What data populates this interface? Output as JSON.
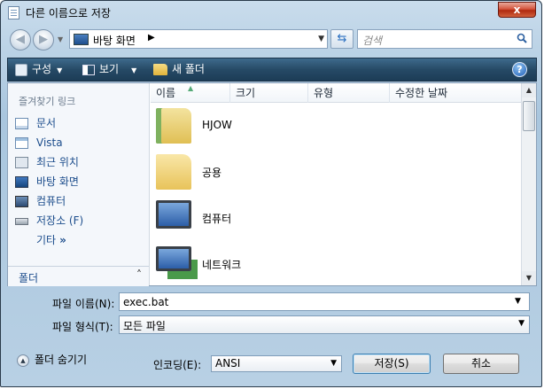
{
  "window": {
    "title": "다른 이름으로 저장",
    "close_glyph": "x"
  },
  "address": {
    "location": "바탕 화면",
    "separator": "▶",
    "search_placeholder": "검색"
  },
  "toolbar": {
    "organize": "구성",
    "views": "보기",
    "new_folder": "새 폴더",
    "help": "?"
  },
  "nav_pane": {
    "title": "즐겨찾기 링크",
    "items": [
      {
        "label": "문서",
        "icon": "documents-icon"
      },
      {
        "label": "Vista",
        "icon": "documents-icon"
      },
      {
        "label": "최근 위치",
        "icon": "recent-places-icon"
      },
      {
        "label": "바탕 화면",
        "icon": "desktop-icon"
      },
      {
        "label": "컴퓨터",
        "icon": "computer-icon"
      },
      {
        "label": "저장소 (F)",
        "icon": "drive-icon"
      }
    ],
    "more_label": "기타",
    "more_chevron": "»",
    "folders_label": "폴더"
  },
  "file_list": {
    "columns": [
      "이름",
      "크기",
      "유형",
      "수정한 날짜"
    ],
    "items": [
      {
        "name": "HJOW",
        "icon": "user-folder-icon"
      },
      {
        "name": "공용",
        "icon": "folder-icon"
      },
      {
        "name": "컴퓨터",
        "icon": "computer-icon"
      },
      {
        "name": "네트워크",
        "icon": "network-icon"
      }
    ]
  },
  "form": {
    "filename_label": "파일 이름(N):",
    "filename_value": "exec.bat",
    "filetype_label": "파일 형식(T):",
    "filetype_value": "모든 파일",
    "hide_folders_label": "폴더 숨기기",
    "encoding_label": "인코딩(E):",
    "encoding_value": "ANSI",
    "save_label": "저장(S)",
    "cancel_label": "취소"
  }
}
